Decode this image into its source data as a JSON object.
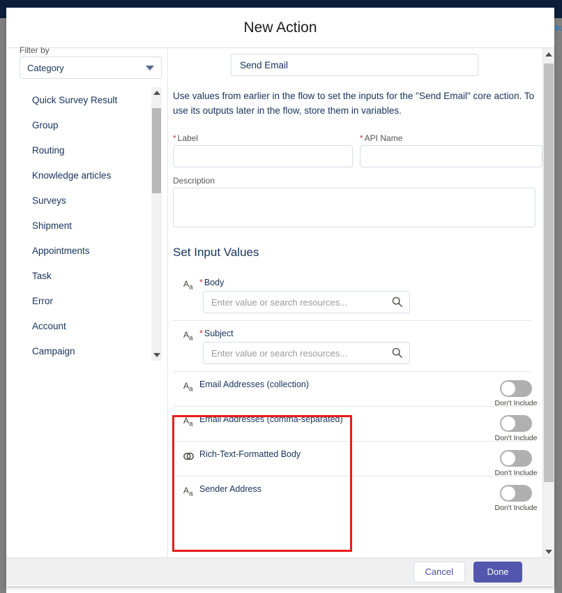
{
  "window": {
    "background_text_right": "to",
    "topbar_color": "#0b1f3a"
  },
  "modal": {
    "title": "New Action",
    "selected_action": "Send Email",
    "help_text": "Use values from earlier in the flow to set the inputs for the \"Send Email\" core action. To use its outputs later in the flow, store them in variables.",
    "section_title": "Set Input Values"
  },
  "sidebar": {
    "filter_label": "Filter by",
    "filter_value": "Category",
    "items": [
      {
        "label": "Quick Survey Result"
      },
      {
        "label": "Group"
      },
      {
        "label": "Routing"
      },
      {
        "label": "Knowledge articles"
      },
      {
        "label": "Surveys"
      },
      {
        "label": "Shipment"
      },
      {
        "label": "Appointments"
      },
      {
        "label": "Task"
      },
      {
        "label": "Error"
      },
      {
        "label": "Account"
      },
      {
        "label": "Campaign"
      }
    ]
  },
  "form": {
    "label_field": {
      "label": "Label",
      "required": true,
      "value": "",
      "placeholder": ""
    },
    "api_name_field": {
      "label": "API Name",
      "required": true,
      "value": "",
      "placeholder": ""
    },
    "description_field": {
      "label": "Description",
      "required": false,
      "value": "",
      "placeholder": ""
    }
  },
  "inputs": {
    "resource_placeholder": "Enter value or search resources...",
    "toggle_off_label": "Don't Include",
    "rows": [
      {
        "label": "Body",
        "required": true,
        "type_icon": "text-type-icon",
        "control": "resource-input",
        "value": ""
      },
      {
        "label": "Subject",
        "required": true,
        "type_icon": "text-type-icon",
        "control": "resource-input",
        "value": ""
      },
      {
        "label": "Email Addresses (collection)",
        "required": false,
        "type_icon": "text-type-icon",
        "control": "toggle",
        "toggle_state": "off",
        "toggle_label": "Don't Include"
      },
      {
        "label": "Email Addresses (comma-separated)",
        "required": false,
        "type_icon": "text-type-icon",
        "control": "toggle",
        "toggle_state": "off",
        "toggle_label": "Don't Include"
      },
      {
        "label": "Rich-Text-Formatted Body",
        "required": false,
        "type_icon": "boolean-type-icon",
        "control": "toggle",
        "toggle_state": "off",
        "toggle_label": "Don't Include"
      },
      {
        "label": "Sender Address",
        "required": false,
        "type_icon": "text-type-icon",
        "control": "toggle",
        "toggle_state": "off",
        "toggle_label": "Don't Include"
      }
    ]
  },
  "footer": {
    "cancel_label": "Cancel",
    "done_label": "Done",
    "done_color": "#5257ad"
  },
  "annotation": {
    "highlight_color": "#e81c1c"
  }
}
